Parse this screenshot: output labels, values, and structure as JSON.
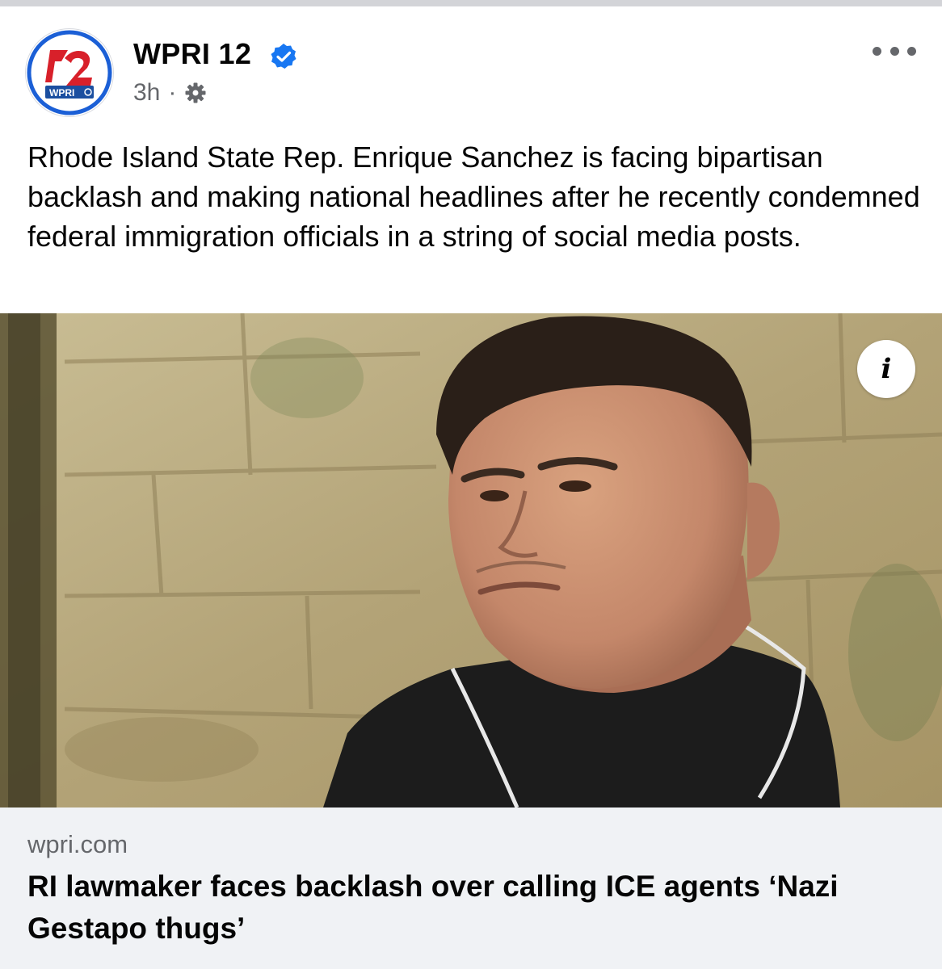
{
  "post": {
    "page_name": "WPRI 12",
    "verified_icon": "verified-badge-icon",
    "timestamp": "3h",
    "separator": "·",
    "audience_icon": "gear-icon",
    "more_icon": "more-options-icon",
    "avatar_logo_text": "WPRI",
    "avatar_logo_number": "12",
    "text": "Rhode Island State Rep. Enrique Sanchez is facing bipartisan backlash and making national headlines after he recently condemned federal immigration officials in a string of social media posts."
  },
  "link_preview": {
    "info_icon": "info-icon",
    "info_glyph": "i",
    "domain": "wpri.com",
    "title": "RI lawmaker faces backlash over calling ICE agents ‘Nazi Gestapo thugs’"
  },
  "colors": {
    "brand_blue": "#1877f2",
    "text_primary": "#050505",
    "text_secondary": "#65676b",
    "card_background": "#f0f2f5",
    "logo_red": "#d8202a",
    "logo_blue": "#1b4fa0"
  }
}
